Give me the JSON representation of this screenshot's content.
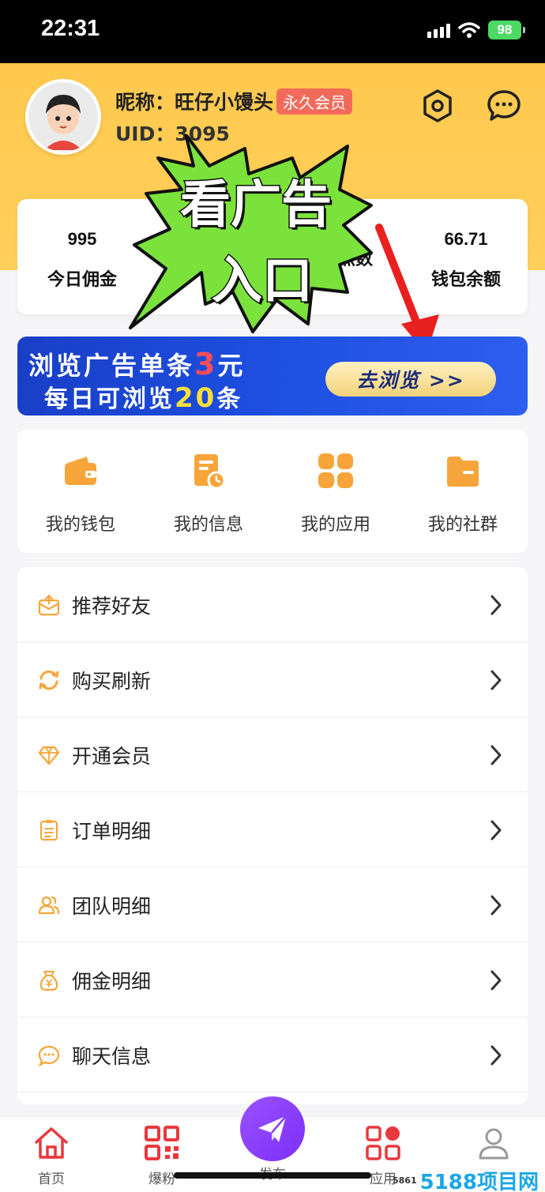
{
  "status_bar": {
    "time": "22:31",
    "battery": "98"
  },
  "profile": {
    "nick_label": "昵称：",
    "nickname": "旺仔小馒头",
    "member_badge": "永久会员",
    "uid_label": "UID：",
    "uid": "3095",
    "settings_icon": "settings-icon",
    "message_icon": "message-icon"
  },
  "stats": [
    {
      "value": "995",
      "label": "今日佣金"
    },
    {
      "value": "",
      "label": ""
    },
    {
      "value": "",
      "label": "点数"
    },
    {
      "value": "66.71",
      "label": "钱包余额"
    }
  ],
  "annotation": {
    "line1": "看广告",
    "line2": "入口"
  },
  "banner": {
    "line1_prefix": "浏览广告单条",
    "line1_amount": "3",
    "line1_suffix": "元",
    "line2_prefix": "每日可浏览",
    "line2_count": "20",
    "line2_suffix": "条",
    "button": "去浏览 >>"
  },
  "quick_actions": [
    {
      "label": "我的钱包",
      "icon": "wallet-icon"
    },
    {
      "label": "我的信息",
      "icon": "info-doc-icon"
    },
    {
      "label": "我的应用",
      "icon": "apps-grid-icon"
    },
    {
      "label": "我的社群",
      "icon": "folder-icon"
    }
  ],
  "menu": [
    {
      "label": "推荐好友",
      "icon": "invite-icon"
    },
    {
      "label": "购买刷新",
      "icon": "refresh-icon"
    },
    {
      "label": "开通会员",
      "icon": "diamond-icon"
    },
    {
      "label": "订单明细",
      "icon": "order-list-icon"
    },
    {
      "label": "团队明细",
      "icon": "team-icon"
    },
    {
      "label": "佣金明细",
      "icon": "money-bag-icon"
    },
    {
      "label": "聊天信息",
      "icon": "chat-icon"
    }
  ],
  "tabbar": [
    {
      "label": "首页",
      "icon": "home-icon"
    },
    {
      "label": "爆粉",
      "icon": "qrcode-icon"
    },
    {
      "label": "发布",
      "icon": "send-icon"
    },
    {
      "label": "应用",
      "icon": "apps-icon"
    },
    {
      "label": "",
      "icon": "profile-icon"
    }
  ],
  "watermark": {
    "small": "5861",
    "big": "5188项目网"
  },
  "colors": {
    "header_yellow": "#ffc94d",
    "accent_orange": "#f7a53a",
    "tab_red": "#e8383d",
    "publish_purple": "#8a3ff9",
    "banner_blue": "#1d4fe0"
  }
}
